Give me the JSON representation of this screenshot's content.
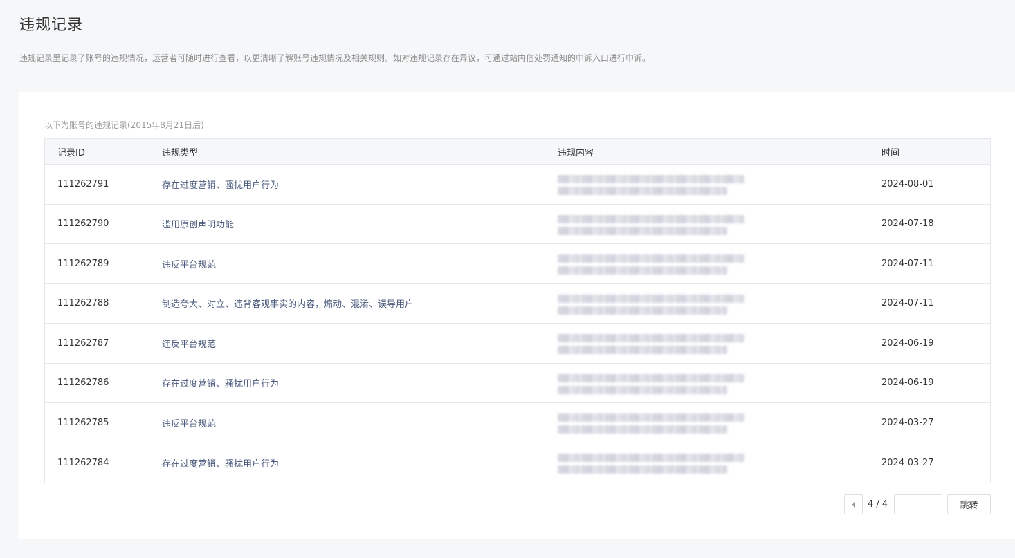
{
  "page": {
    "title": "违规记录",
    "description": "违规记录里记录了账号的违规情况，运营者可随时进行查看，以更清晰了解账号违规情况及相关规则。如对违规记录存在异议，可通过站内信处罚通知的申诉入口进行申诉。"
  },
  "table": {
    "caption": "以下为账号的违规记录(2015年8月21日后)",
    "headers": {
      "id": "记录ID",
      "type": "违规类型",
      "content": "违规内容",
      "time": "时间"
    },
    "rows": [
      {
        "id": "111262791",
        "type": "存在过度营销、骚扰用户行为",
        "time": "2024-08-01"
      },
      {
        "id": "111262790",
        "type": "滥用原创声明功能",
        "time": "2024-07-18"
      },
      {
        "id": "111262789",
        "type": "违反平台规范",
        "time": "2024-07-11"
      },
      {
        "id": "111262788",
        "type": "制造夸大、对立、违背客观事实的内容，煽动、混淆、误导用户",
        "time": "2024-07-11"
      },
      {
        "id": "111262787",
        "type": "违反平台规范",
        "time": "2024-06-19"
      },
      {
        "id": "111262786",
        "type": "存在过度营销、骚扰用户行为",
        "time": "2024-06-19"
      },
      {
        "id": "111262785",
        "type": "违反平台规范",
        "time": "2024-03-27"
      },
      {
        "id": "111262784",
        "type": "存在过度营销、骚扰用户行为",
        "time": "2024-03-27"
      }
    ]
  },
  "pagination": {
    "page_indicator": "4 / 4",
    "jump_input_value": "",
    "jump_label": "跳转"
  }
}
